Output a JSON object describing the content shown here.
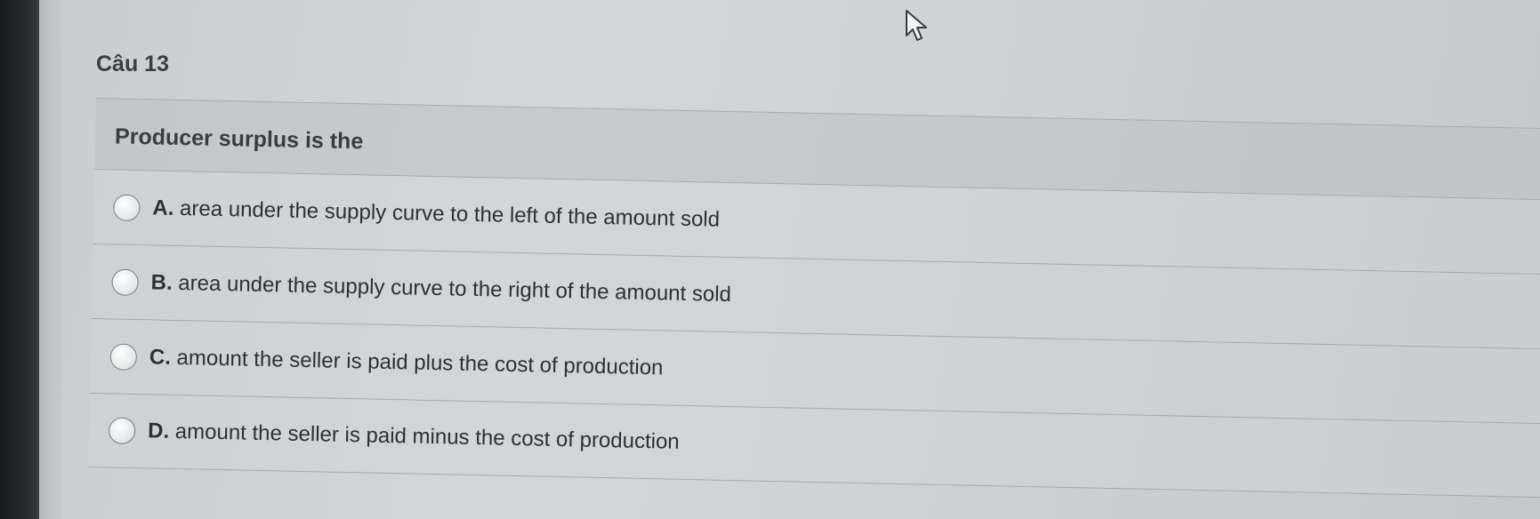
{
  "question": {
    "number_label": "Câu 13",
    "stem": "Producer surplus is the"
  },
  "options": [
    {
      "letter": "A.",
      "text": "area under the supply curve to the left of the amount sold"
    },
    {
      "letter": "B.",
      "text": "area under the supply curve to the right of the amount sold"
    },
    {
      "letter": "C.",
      "text": "amount the seller is paid plus the cost of production"
    },
    {
      "letter": "D.",
      "text": "amount the seller is paid minus the cost of production"
    }
  ],
  "icons": {
    "cursor": "mouse-pointer-icon"
  }
}
